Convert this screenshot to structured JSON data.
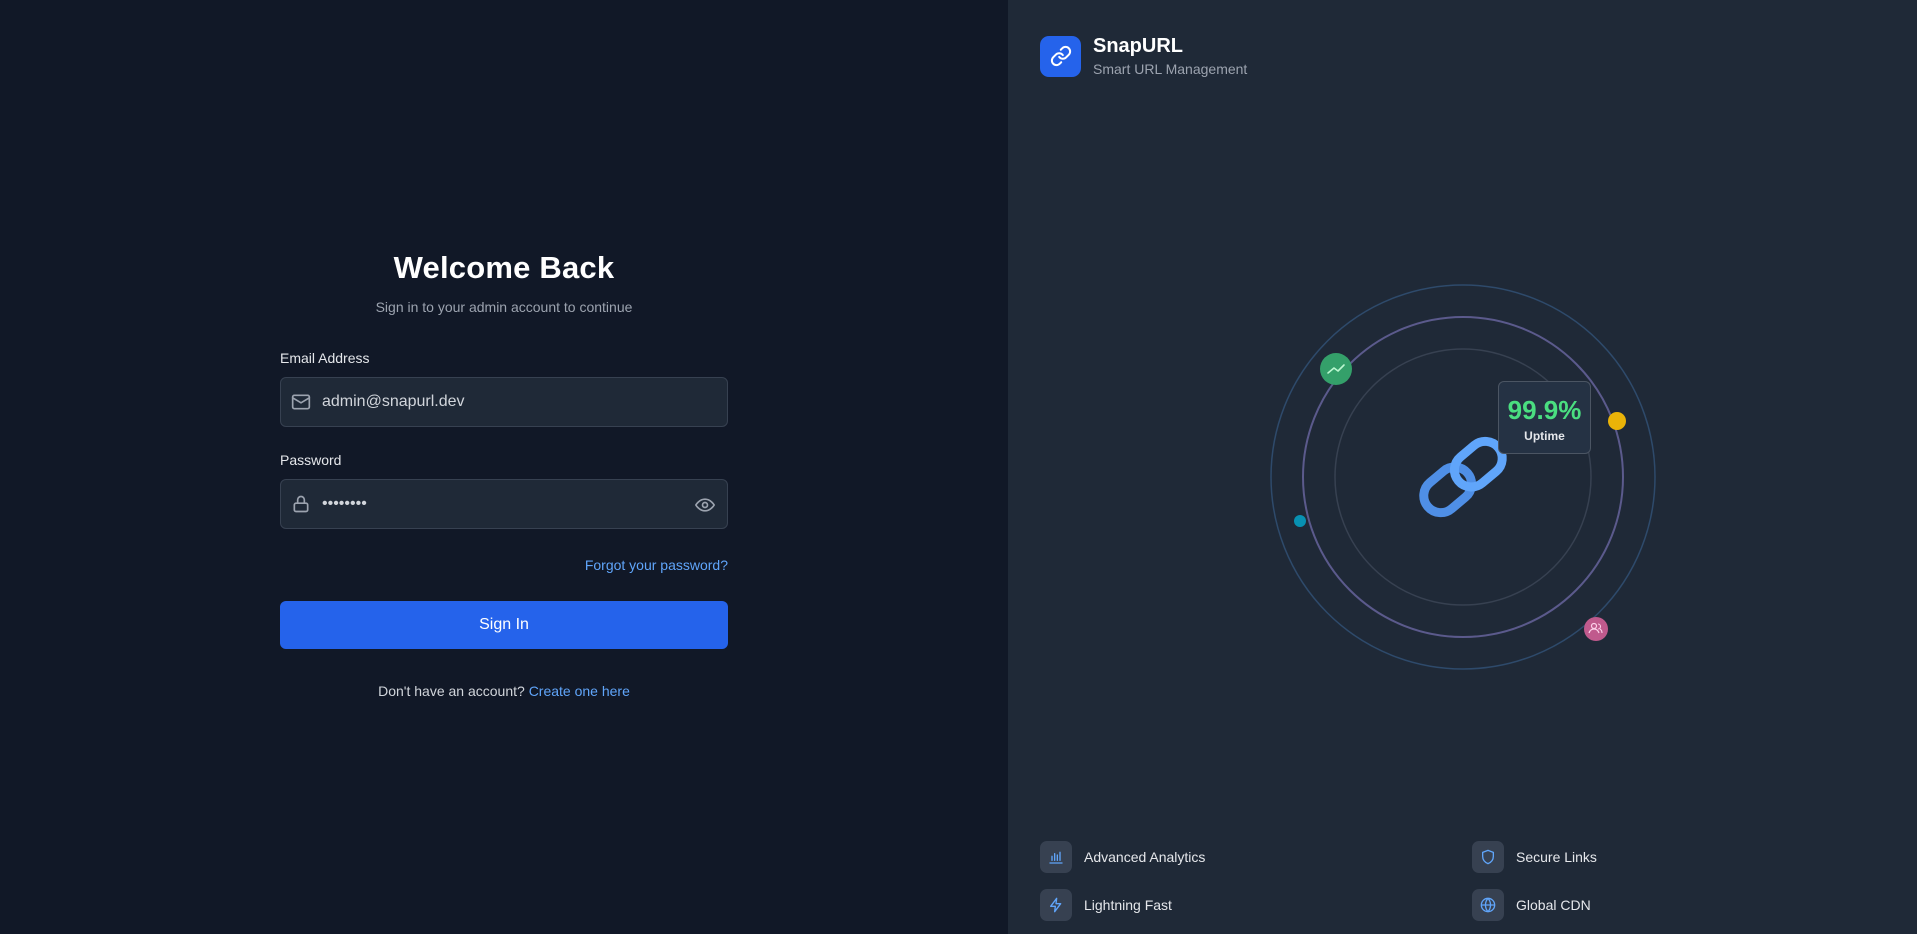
{
  "login": {
    "title": "Welcome Back",
    "subtitle": "Sign in to your admin account to continue",
    "email_label": "Email Address",
    "email_value": "admin@snapurl.dev",
    "password_label": "Password",
    "password_value": "••••••••",
    "forgot_link": "Forgot your password?",
    "signin_button": "Sign In",
    "register_prompt": "Don't have an account?",
    "register_link": "Create one here"
  },
  "brand": {
    "name": "SnapURL",
    "tagline": "Smart URL Management",
    "logo_icon": "link-icon",
    "accent": "#2563eb"
  },
  "stats": {
    "uptime_value": "99.9%",
    "uptime_label": "Uptime",
    "uptime_color": "#4ade80"
  },
  "features": [
    {
      "label": "Advanced Analytics",
      "icon": "bar-chart-icon"
    },
    {
      "label": "Secure Links",
      "icon": "shield-icon"
    },
    {
      "label": "Lightning Fast",
      "icon": "lightning-icon"
    },
    {
      "label": "Global CDN",
      "icon": "globe-icon"
    }
  ],
  "orbit_dots": [
    {
      "icon": "trending-icon",
      "color": "#34a06a"
    },
    {
      "icon": "dot",
      "color": "#eab308"
    },
    {
      "icon": "dot",
      "color": "#0891b2"
    },
    {
      "icon": "users-icon",
      "color": "#c05a8d"
    }
  ]
}
